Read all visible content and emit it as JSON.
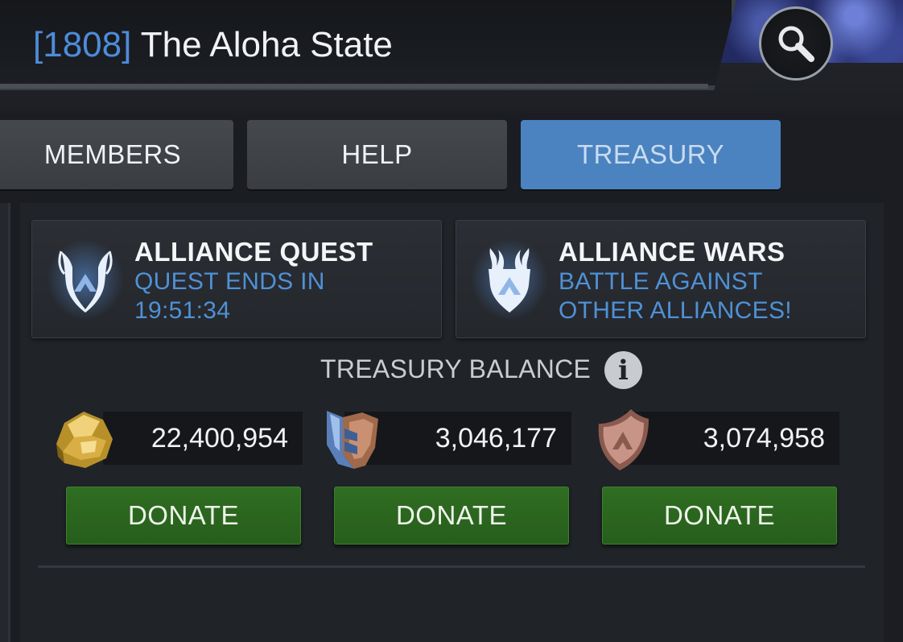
{
  "header": {
    "alliance_tag": "[1808]",
    "alliance_name": "The Aloha State",
    "search_icon": "search-icon"
  },
  "tabs": [
    {
      "label": "MEMBERS",
      "active": false
    },
    {
      "label": "HELP",
      "active": false
    },
    {
      "label": "TREASURY",
      "active": true
    }
  ],
  "modes": [
    {
      "title": "ALLIANCE QUEST",
      "subtitle_line1": "QUEST ENDS IN",
      "subtitle_line2": "19:51:34",
      "icon": "alliance-quest-emblem-icon"
    },
    {
      "title": "ALLIANCE WARS",
      "subtitle_line1": "BATTLE AGAINST",
      "subtitle_line2": "OTHER ALLIANCES!",
      "icon": "alliance-wars-emblem-icon"
    }
  ],
  "treasury": {
    "label": "TREASURY BALANCE",
    "info_icon": "i",
    "currencies": [
      {
        "icon": "gold-ore-icon",
        "amount": "22,400,954",
        "button": "DONATE"
      },
      {
        "icon": "battlechip-icon",
        "amount": "3,046,177",
        "button": "DONATE"
      },
      {
        "icon": "loyalty-shield-icon",
        "amount": "3,074,958",
        "button": "DONATE"
      }
    ]
  },
  "colors": {
    "accent_blue": "#4b83c0",
    "subtitle_blue": "#4f91d6",
    "donate_green": "#2f6e22",
    "background": "#202328"
  }
}
